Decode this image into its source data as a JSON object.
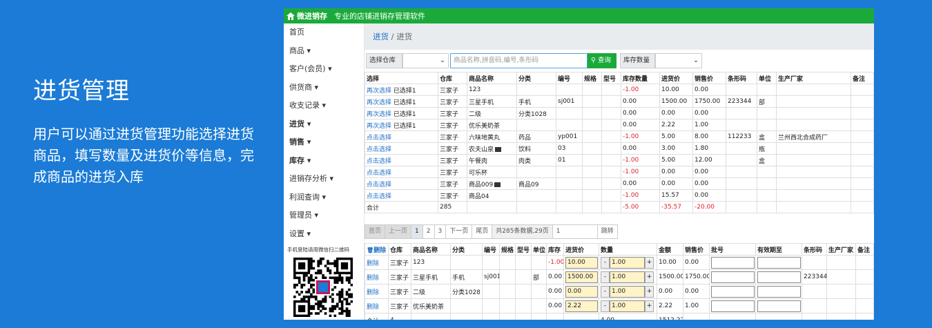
{
  "promo": {
    "title": "进货管理",
    "description": "用户可以通过进货管理功能选择进货商品，填写数量及进货价等信息，完成商品的进货入库"
  },
  "app": {
    "name": "微进销存",
    "slogan": "专业的店铺进销存管理软件"
  },
  "sidebar": {
    "items": [
      {
        "label": "首页"
      },
      {
        "label": "商品 ▾"
      },
      {
        "label": "客户(会员) ▾"
      },
      {
        "label": "供货商 ▾"
      },
      {
        "label": "收支记录 ▾"
      },
      {
        "label": "进货 ▾"
      },
      {
        "label": "销售 ▾"
      },
      {
        "label": "库存 ▾"
      },
      {
        "label": "进销存分析 ▾"
      },
      {
        "label": "利润查询 ▾"
      },
      {
        "label": "管理员 ▾"
      },
      {
        "label": "设置 ▾"
      }
    ],
    "qr_tip": "手机登陆请用微信扫二维码"
  },
  "breadcrumb": {
    "parent": "进货",
    "current": "进货"
  },
  "search": {
    "warehouse_label": "选择仓库",
    "placeholder": "商品名称,拼音码,编号,条形码",
    "query_button": "查询",
    "stock_label": "库存数量"
  },
  "products": {
    "headers": [
      "选择",
      "仓库",
      "商品名称",
      "分类",
      "编号",
      "规格",
      "型号",
      "库存数量",
      "进货价",
      "销售价",
      "条形码",
      "单位",
      "生产厂家",
      "备注"
    ],
    "rows": [
      {
        "select": "再次选择",
        "selected": "已选择1",
        "warehouse": "三家子",
        "name": "123",
        "category": "",
        "code": "",
        "spec": "",
        "model": "",
        "stock": "-1.00",
        "cost": "10.00",
        "price": "0.00",
        "barcode": "",
        "unit": "",
        "maker": "",
        "note": ""
      },
      {
        "select": "再次选择",
        "selected": "已选择1",
        "warehouse": "三家子",
        "name": "三星手机",
        "category": "手机",
        "code": "sj001",
        "spec": "",
        "model": "",
        "stock": "0.00",
        "cost": "1500.00",
        "price": "1750.00",
        "barcode": "223344",
        "unit": "部",
        "maker": "",
        "note": ""
      },
      {
        "select": "再次选择",
        "selected": "已选择1",
        "warehouse": "三家子",
        "name": "二级",
        "category": "分类1028",
        "code": "",
        "spec": "",
        "model": "",
        "stock": "0.00",
        "cost": "0.00",
        "price": "0.00",
        "barcode": "",
        "unit": "",
        "maker": "",
        "note": ""
      },
      {
        "select": "再次选择",
        "selected": "已选择1",
        "warehouse": "三家子",
        "name": "优乐美奶茶",
        "category": "",
        "code": "",
        "spec": "",
        "model": "",
        "stock": "0.00",
        "cost": "2.22",
        "price": "1.00",
        "barcode": "",
        "unit": "",
        "maker": "",
        "note": ""
      },
      {
        "select": "点击选择",
        "selected": "",
        "warehouse": "三家子",
        "name": "六味地黄丸",
        "category": "药品",
        "code": "yp001",
        "spec": "",
        "model": "",
        "stock": "-1.00",
        "cost": "5.00",
        "price": "8.00",
        "barcode": "112233",
        "unit": "盒",
        "maker": "兰州西北合成药厂",
        "note": ""
      },
      {
        "select": "点击选择",
        "selected": "",
        "warehouse": "三家子",
        "name": "农夫山泉",
        "image": true,
        "category": "饮料",
        "code": "03",
        "spec": "",
        "model": "",
        "stock": "0.00",
        "cost": "3.00",
        "price": "1.80",
        "barcode": "",
        "unit": "瓶",
        "maker": "",
        "note": ""
      },
      {
        "select": "点击选择",
        "selected": "",
        "warehouse": "三家子",
        "name": "午餐肉",
        "category": "肉类",
        "code": "01",
        "spec": "",
        "model": "",
        "stock": "-1.00",
        "cost": "5.00",
        "price": "12.00",
        "barcode": "",
        "unit": "盒",
        "maker": "",
        "note": ""
      },
      {
        "select": "点击选择",
        "selected": "",
        "warehouse": "三家子",
        "name": "可乐杯",
        "category": "",
        "code": "",
        "spec": "",
        "model": "",
        "stock": "-1.00",
        "cost": "0.00",
        "price": "0.00",
        "barcode": "",
        "unit": "",
        "maker": "",
        "note": ""
      },
      {
        "select": "点击选择",
        "selected": "",
        "warehouse": "三家子",
        "name": "商品009",
        "image": true,
        "category": "商品09",
        "code": "",
        "spec": "",
        "model": "",
        "stock": "0.00",
        "cost": "0.00",
        "price": "0.00",
        "barcode": "",
        "unit": "",
        "maker": "",
        "note": ""
      },
      {
        "select": "点击选择",
        "selected": "",
        "warehouse": "三家子",
        "name": "商品04",
        "category": "",
        "code": "",
        "spec": "",
        "model": "",
        "stock": "-1.00",
        "cost": "15.57",
        "price": "0.00",
        "barcode": "",
        "unit": "",
        "maker": "",
        "note": ""
      }
    ],
    "total": {
      "label": "合计",
      "warehouse": "285",
      "stock": "-5.00",
      "cost": "-35.57",
      "price": "-20.00"
    }
  },
  "pager": {
    "first": "首页",
    "prev": "上一页",
    "pages": [
      "1",
      "2",
      "3"
    ],
    "next": "下一页",
    "last": "尾页",
    "info": "共285条数据,29页",
    "page_value": "1",
    "jump": "跳转"
  },
  "cart": {
    "headers": [
      "删除",
      "仓库",
      "商品名称",
      "分类",
      "编号",
      "规格",
      "型号",
      "单位",
      "库存",
      "进货价",
      "数量",
      "金额",
      "销售价",
      "批号",
      "有效期至",
      "条形码",
      "生产厂家",
      "备注"
    ],
    "rows": [
      {
        "del": "删除",
        "warehouse": "三家子",
        "name": "123",
        "category": "",
        "code": "",
        "spec": "",
        "model": "",
        "unit": "",
        "stock": "-1.00",
        "cost": "10.00",
        "qty": "1.00",
        "amount": "10.00",
        "price": "0.00",
        "barcode": ""
      },
      {
        "del": "删除",
        "warehouse": "三家子",
        "name": "三星手机",
        "category": "手机",
        "code": "sj001",
        "spec": "",
        "model": "",
        "unit": "部",
        "stock": "0.00",
        "cost": "1500.00",
        "qty": "1.00",
        "amount": "1500.00",
        "price": "1750.00",
        "barcode": "223344"
      },
      {
        "del": "删除",
        "warehouse": "三家子",
        "name": "二级",
        "category": "分类1028",
        "code": "",
        "spec": "",
        "model": "",
        "unit": "",
        "stock": "0.00",
        "cost": "0.00",
        "qty": "1.00",
        "amount": "0.00",
        "price": "0.00",
        "barcode": ""
      },
      {
        "del": "删除",
        "warehouse": "三家子",
        "name": "优乐美奶茶",
        "category": "",
        "code": "",
        "spec": "",
        "model": "",
        "unit": "",
        "stock": "0.00",
        "cost": "2.22",
        "qty": "1.00",
        "amount": "2.22",
        "price": "1.00",
        "barcode": ""
      }
    ],
    "total": {
      "label": "合计",
      "warehouse": "4",
      "qty": "4.00",
      "amount": "1512.22"
    }
  },
  "colors": {
    "background": "#1b7bd6",
    "topbar": "#1aaa3a",
    "link": "#1f6fc5",
    "negative": "#d9232d"
  }
}
